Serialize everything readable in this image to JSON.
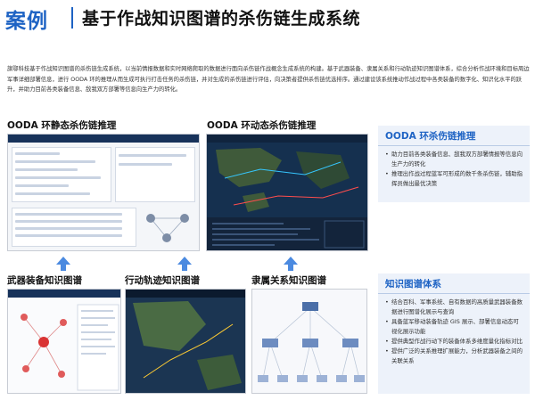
{
  "header": {
    "case_label": "案例",
    "title": "基于作战知识图谱的杀伤链生成系统"
  },
  "intro": "旗鄂科技基于作战知识图谱的杀伤链生成系统，以当前情报数据和实时网络爬取的数据进行面向杀伤链作战概念生成系统的构建。基于武器装备、隶属关系和行动轨迹知识图谱体系，综合分析作战环境和目标周边军事详细部署信息，进行 OODA 环的推理从而生成可执行打击任务的杀伤链，并对生成的杀伤链进行评估，向决策者提供杀伤链优选排序。通过建设该系统推动作战过程中各类装备的数字化、知识化水平的跃升，并助力目前各类装备信息、敌我双方部署等信息向生产力的转化。",
  "sections": {
    "static_ooda": "OODA 环静态杀伤链推理",
    "dynamic_ooda": "OODA 环动态杀伤链推理",
    "weapon_graph": "武器装备知识图谱",
    "track_graph": "行动轨迹知识图谱",
    "affiliation_graph": "隶属关系知识图谱"
  },
  "panel_ooda": {
    "title": "OODA 环杀伤链推理",
    "items": [
      "助力目前各类装备信息、敌我双方部署情报等信息向生产力的转化",
      "推理出作战过程蓝军可形成的数千条杀伤链，辅助指挥员做出最优决策"
    ]
  },
  "panel_kg": {
    "title": "知识图谱体系",
    "items": [
      "结合百科、军事系统、自有数据的高质量武器装备数据进行图谱化展示与查询",
      "具备蓝军移动装备轨迹 GIS 展示、部署信息动态可视化展示功能",
      "提供典型作战行动下的装备体系多维度量化指标对比",
      "提供广泛的关系推理扩展能力，分析武器装备之间的关联关系"
    ]
  },
  "colors": {
    "accent": "#1e63c4",
    "arrow": "#4b8ae0",
    "panel_bg": "#edf2fa",
    "dark_bar": "#10243e"
  }
}
